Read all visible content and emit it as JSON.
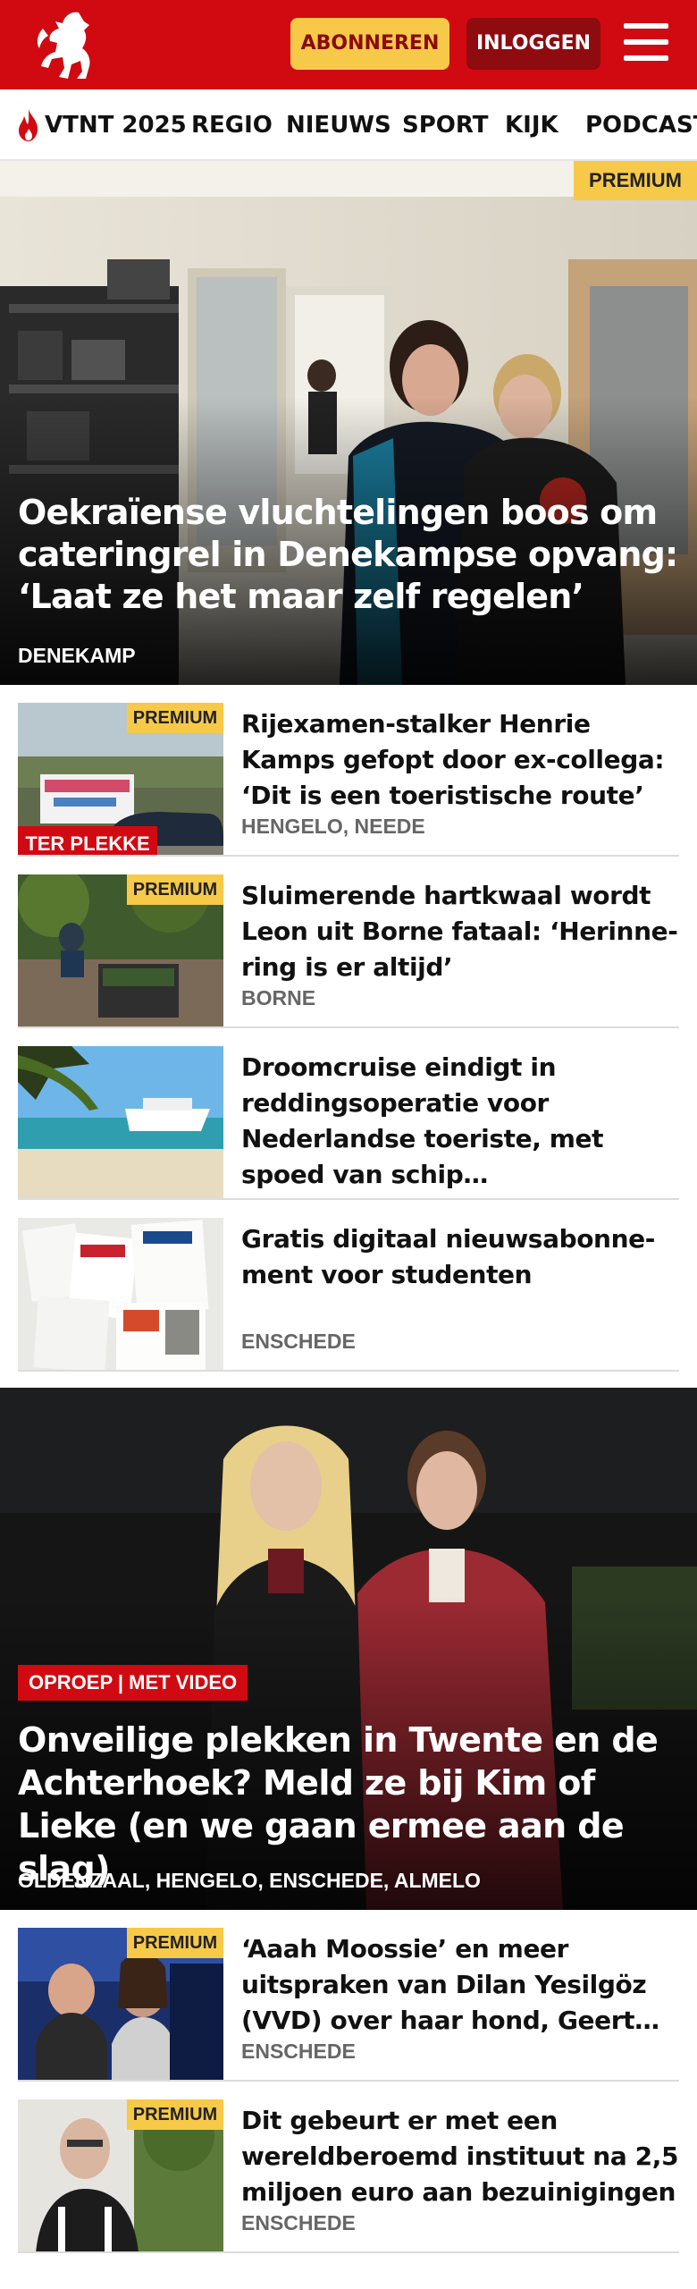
{
  "header": {
    "logo_icon": "tubantia-horse-logo-icon",
    "subscribe_label": "ABONNEREN",
    "login_label": "INLOGGEN",
    "menu_icon": "hamburger-menu-icon",
    "brand_color": "#d10a11",
    "subscribe_color": "#f7c948"
  },
  "nav": {
    "items": [
      {
        "label": "VTNT 2025",
        "icon": "flame-icon"
      },
      {
        "label": "REGIO"
      },
      {
        "label": "NIEUWS"
      },
      {
        "label": "SPORT"
      },
      {
        "label": "KIJK"
      },
      {
        "label": "PODCAST"
      }
    ]
  },
  "hero": {
    "badge": "PREMIUM",
    "title": "Oekraïense vluchtelingen boos om cateringrel in Denekampse opvang: ‘Laat ze het maar zelf regelen’",
    "location": "DENEKAMP"
  },
  "articles": [
    {
      "badge": "PREMIUM",
      "label": "TER PLEKKE",
      "title": "Rijexamen-stalker Henrie Kamps gefopt door ex-collega: ‘Dit is een toeristische route’",
      "location": "HENGELO, NEEDE"
    },
    {
      "badge": "PREMIUM",
      "title": "Sluimerende hartkwaal wordt Leon uit Borne fataal: ‘Herinne­ring is er altijd’",
      "location": "BORNE"
    },
    {
      "title": "Droomcruise eindigt in reddings­operatie voor Nederlandse toeriste, met spoed van schip…"
    },
    {
      "title": "Gratis digitaal nieuwsabonne­ment voor studenten",
      "location": "ENSCHEDE"
    }
  ],
  "hero2": {
    "label": "OPROEP | MET VIDEO",
    "title": "Onveilige plekken in Twente en de Achterhoek? Meld ze bij Kim of Lieke (en we gaan ermee aan de slag)",
    "location": "OLDENZAAL, HENGELO, ENSCHEDE, ALMELO"
  },
  "articles2": [
    {
      "badge": "PREMIUM",
      "title": "‘Aaah Moossie’ en meer uitspraken van Dilan Yesilgöz (VVD) over haar hond, Geert…",
      "location": "ENSCHEDE"
    },
    {
      "badge": "PREMIUM",
      "title": "Dit gebeurt er met een wereldbe­roemd instituut na 2,5 miljoen euro aan bezuinigingen",
      "location": "ENSCHEDE"
    }
  ]
}
